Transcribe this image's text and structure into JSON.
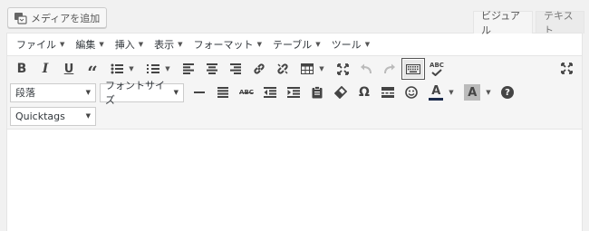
{
  "media_button": {
    "label": "メディアを追加"
  },
  "tabs": {
    "visual": "ビジュアル",
    "text": "テキスト"
  },
  "menubar": [
    "ファイル",
    "編集",
    "挿入",
    "表示",
    "フォーマット",
    "テーブル",
    "ツール"
  ],
  "toolbar": {
    "bold": "B",
    "italic": "I",
    "underline": "U",
    "spellcheck": "ABC",
    "strikethrough": "ABC",
    "special_char": "Ω",
    "text_color": "A",
    "bg_color": "A",
    "help": "?"
  },
  "selects": {
    "block_format": "段落",
    "font_size": "フォントサイズ",
    "quicktags": "Quicktags"
  }
}
